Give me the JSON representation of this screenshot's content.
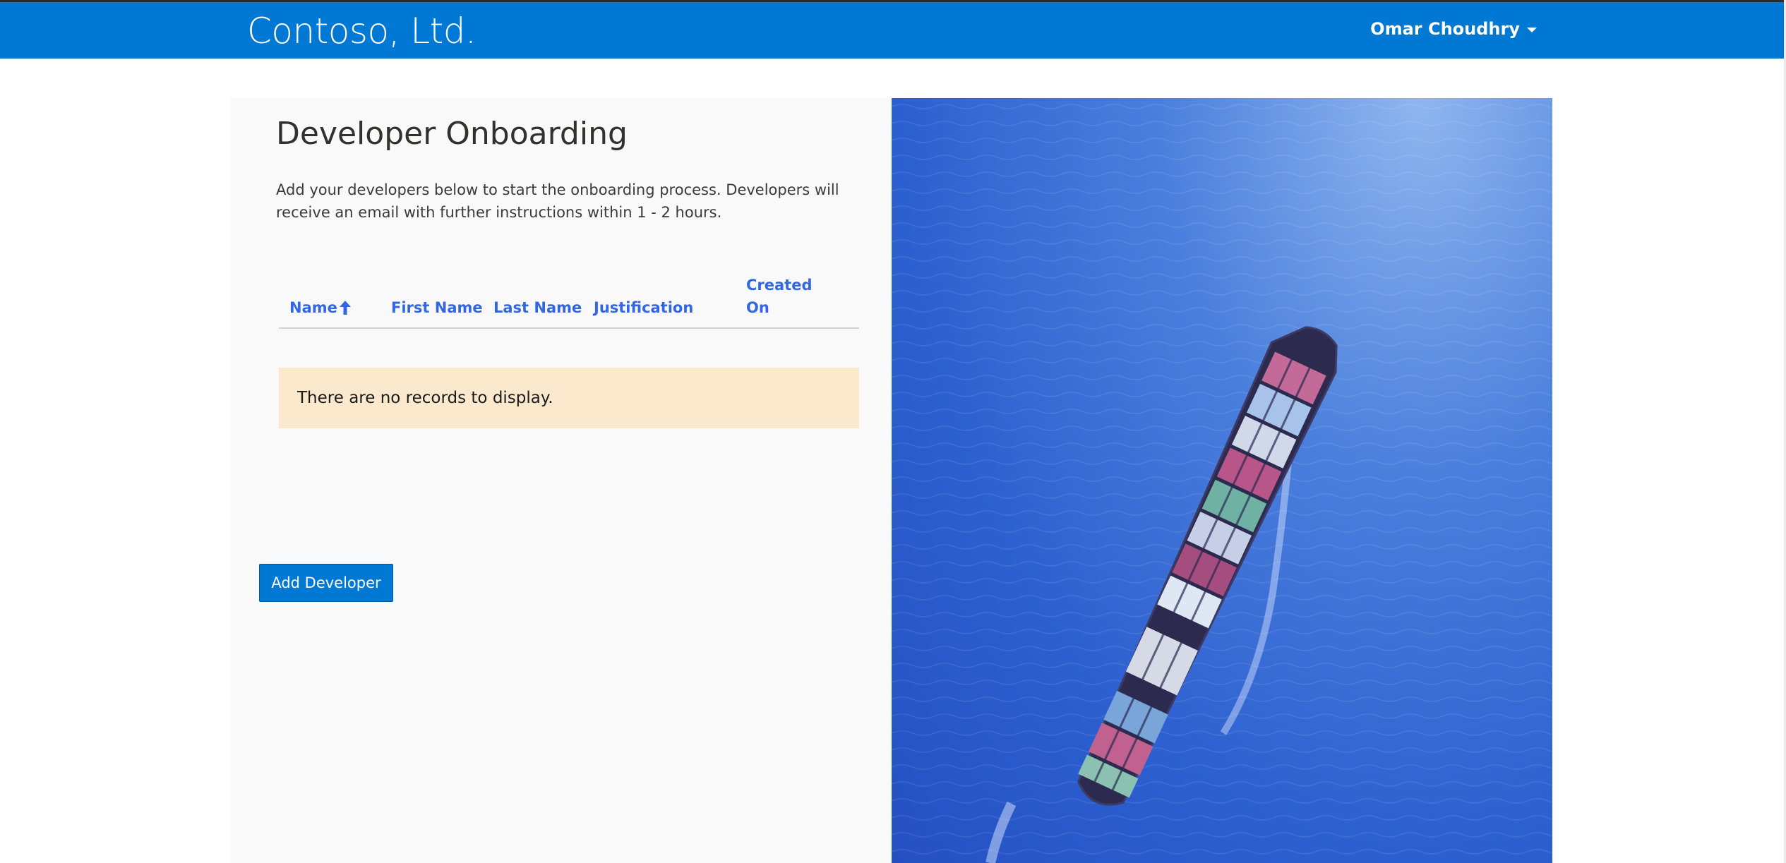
{
  "navbar": {
    "brand": "Contoso, Ltd.",
    "user_name": "Omar Choudhry",
    "accent": "#0078d4"
  },
  "main": {
    "title": "Developer Onboarding",
    "description": "Add your developers below to start the onboarding process. Developers will receive an email with further instructions within 1 - 2 hours.",
    "grid": {
      "columns": [
        {
          "label": "Name",
          "sorted": "ascending"
        },
        {
          "label": "First Name"
        },
        {
          "label": "Last Name"
        },
        {
          "label": "Justification"
        },
        {
          "label": "Created On"
        }
      ],
      "empty_message": "There are no records to display."
    },
    "add_button_label": "Add Developer"
  },
  "hero": {
    "icon": "container-ship-image"
  }
}
